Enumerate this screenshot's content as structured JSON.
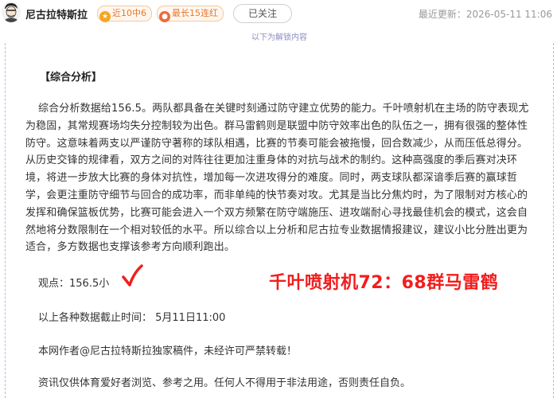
{
  "header": {
    "author_name": "尼古拉特斯拉",
    "badge_recent": "近10中6",
    "badge_streak": "最长15连红",
    "follow_label": "已关注",
    "update_time": "最近更新：2026-05-11 11:06"
  },
  "unlock_banner": "以下为解锁内容",
  "article": {
    "section_title": "【综合分析】",
    "analysis_paragraph": "综合分析数据给156.5。两队都具备在关键时刻通过防守建立优势的能力。千叶喷射机在主场的防守表现尤为稳固，其常规赛场均失分控制较为出色。群马雷鹤则是联盟中防守效率出色的队伍之一，拥有很强的整体性防守。这意味着两支以严谨防守著称的球队相遇，比赛的节奏可能会被拖慢，回合数减少，从而压低总得分。从历史交锋的规律看，双方之间的对阵往往更加注重身体的对抗与战术的制约。这种高强度的季后赛对决环境，将进一步放大比赛的身体对抗性，增加每一次进攻得分的难度。同时，两支球队都深谙季后赛的赢球哲学，会更注重防守细节与回合的成功率，而非单纯的快节奏对攻。尤其是当比分焦灼时，为了限制对方核心的发挥和确保篮板优势，比赛可能会进入一个双方频繁在防守端施压、进攻端耐心寻找最佳机会的模式，这会自然地将分数限制在一个相对较低的水平。所以综合以上分析和尼古拉专业数据情报建议，建议小比分胜出更为适合，多方数据也支撑该参考方向顺利跑出。",
    "viewpoint": "观点：156.5小",
    "score_text": "千叶喷射机72：68群马雷鹤",
    "data_cutoff": "以上各种数据截止时间： 5月11日11:00",
    "copyright_note": "本网作者@尼古拉特斯拉独家稿件，未经许可严禁转载！",
    "disclaimer": "资讯仅供体育爱好者浏览、参考之用。任何人不得用于非法用途，否则责任自负。"
  },
  "colors": {
    "accent_red": "#f21d1d",
    "badge_orange": "#e07a2f",
    "dashed_border": "#b9b6e6",
    "muted_text": "#999999"
  },
  "icons": {
    "avatar": "avatar-portrait",
    "badge_recent_icon": "star-icon",
    "badge_streak_icon": "fire-icon",
    "checkmark": "checkmark-icon"
  }
}
